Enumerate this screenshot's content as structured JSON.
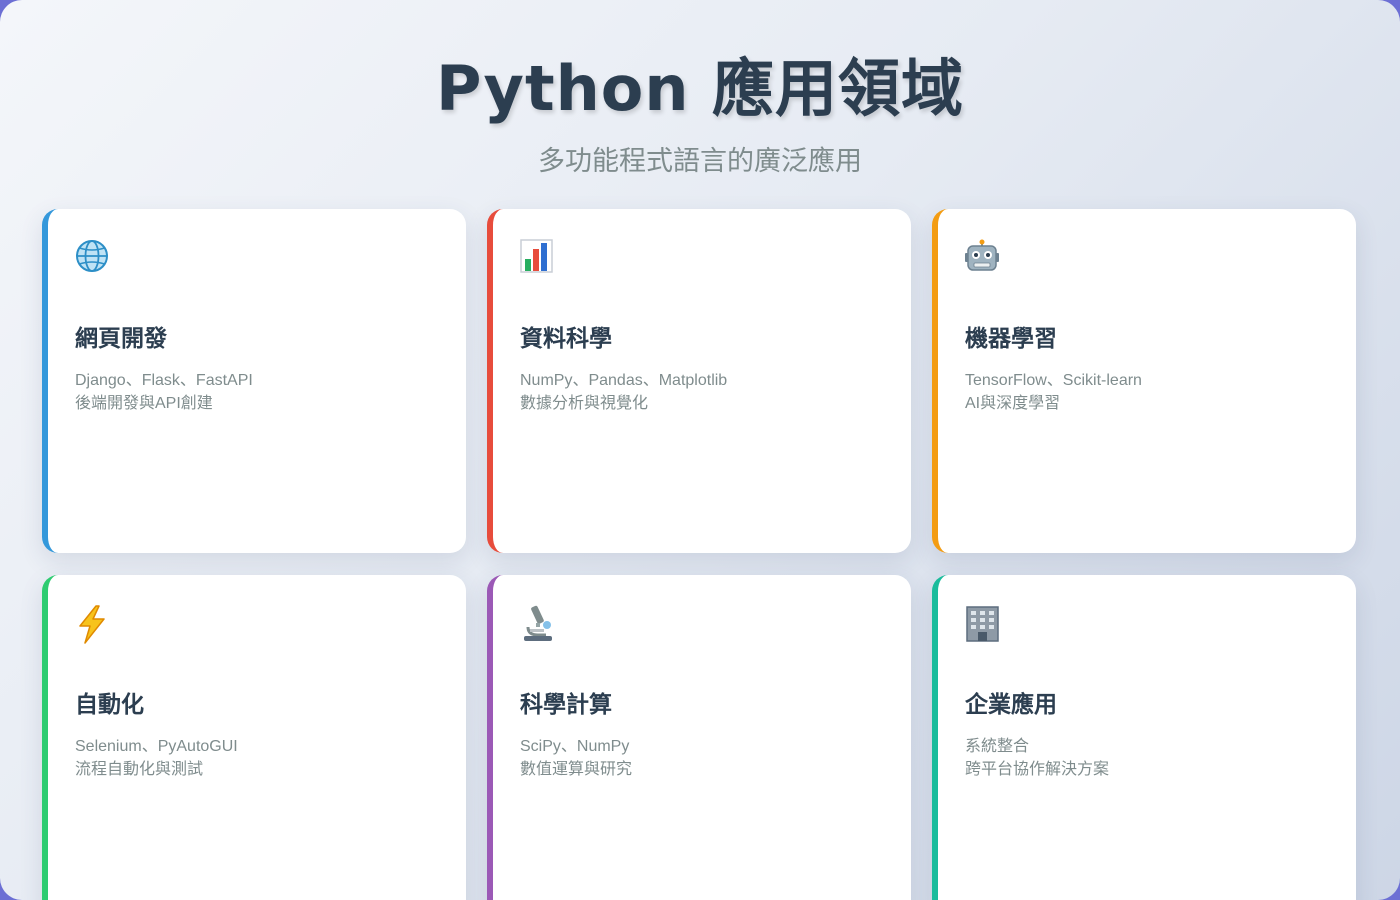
{
  "header": {
    "title": "Python 應用領域",
    "subtitle": "多功能程式語言的廣泛應用"
  },
  "cards": [
    {
      "icon": "globe-icon",
      "title": "網頁開發",
      "line1": "Django、Flask、FastAPI",
      "line2": "後端開發與API創建",
      "accent": "#3498db"
    },
    {
      "icon": "bar-chart-icon",
      "title": "資料科學",
      "line1": "NumPy、Pandas、Matplotlib",
      "line2": "數據分析與視覺化",
      "accent": "#e74c3c"
    },
    {
      "icon": "robot-icon",
      "title": "機器學習",
      "line1": "TensorFlow、Scikit-learn",
      "line2": "AI與深度學習",
      "accent": "#f39c12"
    },
    {
      "icon": "lightning-icon",
      "title": "自動化",
      "line1": "Selenium、PyAutoGUI",
      "line2": "流程自動化與測試",
      "accent": "#2ecc71"
    },
    {
      "icon": "microscope-icon",
      "title": "科學計算",
      "line1": "SciPy、NumPy",
      "line2": "數值運算與研究",
      "accent": "#9b59b6"
    },
    {
      "icon": "office-building-icon",
      "title": "企業應用",
      "line1": "系統整合",
      "line2": "跨平台協作解決方案",
      "accent": "#1abc9c"
    }
  ]
}
